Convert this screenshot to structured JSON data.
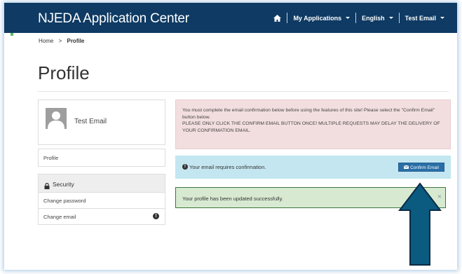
{
  "header": {
    "brand": "NJEDA Application Center",
    "my_applications": "My Applications",
    "language": "English",
    "user_menu": "Test Email"
  },
  "breadcrumb": {
    "home": "Home",
    "separator": ">",
    "current": "Profile"
  },
  "page": {
    "title": "Profile"
  },
  "sidebar": {
    "user_name": "Test Email",
    "profile_link": "Profile",
    "security_heading": "Security",
    "items": [
      {
        "label": "Change password"
      },
      {
        "label": "Change email",
        "badge": "!"
      }
    ]
  },
  "alerts": {
    "warning_line1": "You must complete the email confirmation below before using the features of this site! Please select the \"Confirm Email\" button below.",
    "warning_line2": "PLEASE ONLY CLICK THE CONFIRM EMAIL BUTTON ONCE! MULTIPLE REQUESTS MAY DELAY THE DELIVERY OF YOUR CONFIRMATION EMAIL.",
    "info_message": "Your email requires confirmation.",
    "confirm_button": "Confirm Email",
    "success_message": "Your profile has been updated successfully.",
    "close_symbol": "×"
  },
  "icons": {
    "home": "home-icon",
    "lock": "lock-icon",
    "exclamation": "exclamation-circle-icon",
    "envelope": "envelope-icon",
    "avatar": "user-avatar-icon",
    "arrow": "up-arrow-annotation-icon"
  },
  "colors": {
    "navbar": "#0e3a63",
    "danger_bg": "#f2dede",
    "info_bg": "#c4e6f1",
    "success_bg": "#d7ead1",
    "button": "#2a6fa7",
    "arrow_fill": "#0b5a80",
    "arrow_stroke": "#0a2a44"
  }
}
